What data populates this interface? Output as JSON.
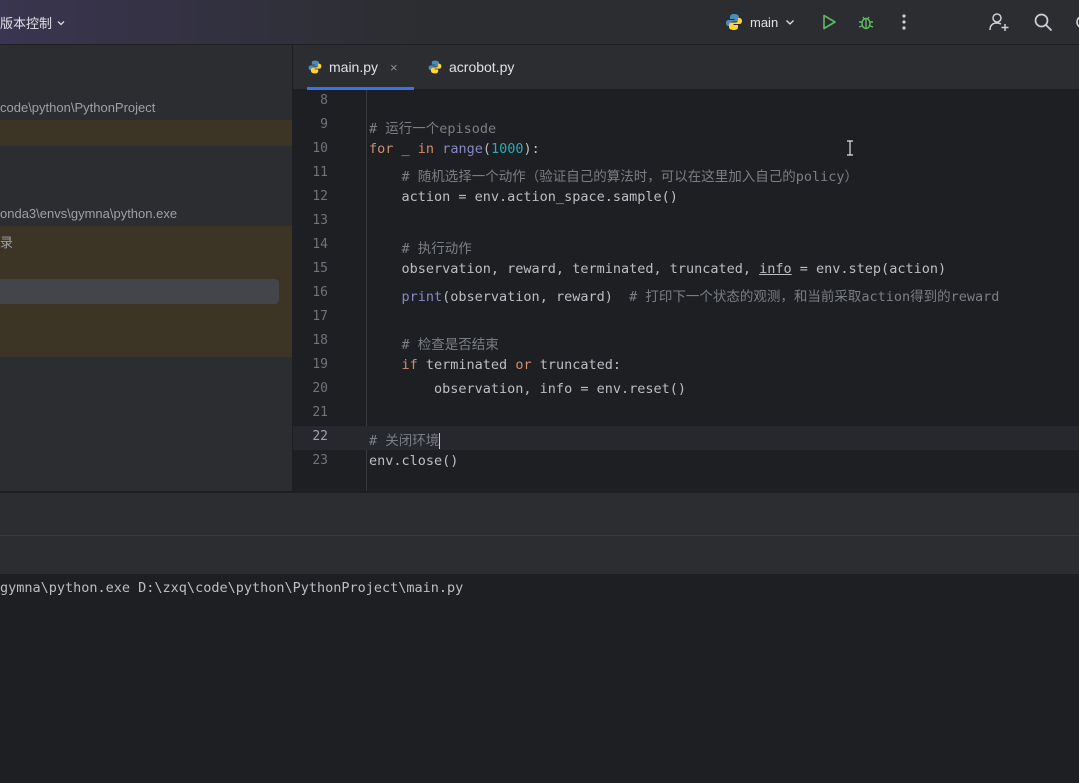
{
  "titlebar": {
    "vcs_label": "版本控制",
    "run_config": "main",
    "colors": {
      "run": "#5fb865",
      "debug": "#5fb865"
    }
  },
  "sidebar": {
    "project_path": "code\\python\\PythonProject",
    "interpreter_path": "onda3\\envs\\gymna\\python.exe",
    "dir_label": "录"
  },
  "tabs": [
    {
      "label": "main.py",
      "close": "×"
    },
    {
      "label": "acrobot.py"
    }
  ],
  "editor": {
    "current_line": 22,
    "lines": [
      {
        "n": "8",
        "text": ""
      },
      {
        "n": "9",
        "comment": "# 运行一个episode"
      },
      {
        "n": "10",
        "kw1": "for",
        "t1": " _ ",
        "kw2": "in",
        "t2": " ",
        "bi": "range",
        "p1": "(",
        "num": "1000",
        "p2": "):"
      },
      {
        "n": "11",
        "indent": "    ",
        "comment": "# 随机选择一个动作（验证自己的算法时，可以在这里加入自己的policy）"
      },
      {
        "n": "12",
        "text": "    action = env.action_space.sample()"
      },
      {
        "n": "13",
        "text": ""
      },
      {
        "n": "14",
        "indent": "    ",
        "comment": "# 执行动作"
      },
      {
        "n": "15",
        "pre": "    observation, reward, terminated, truncated, ",
        "ul": "info",
        "post": " = env.step(action)"
      },
      {
        "n": "16",
        "indent": "    ",
        "bi": "print",
        "mid": "(observation, reward)  ",
        "comment": "# 打印下一个状态的观测，和当前采取action得到的reward"
      },
      {
        "n": "17",
        "text": ""
      },
      {
        "n": "18",
        "indent": "    ",
        "comment": "# 检查是否结束"
      },
      {
        "n": "19",
        "indent": "    ",
        "kw1": "if",
        "t1": " terminated ",
        "kw2": "or",
        "t2": " truncated:"
      },
      {
        "n": "20",
        "text": "        observation, info = env.reset()"
      },
      {
        "n": "21",
        "text": ""
      },
      {
        "n": "22",
        "comment": "# 关闭环境"
      },
      {
        "n": "23",
        "text": "env.close()"
      }
    ]
  },
  "console": {
    "command": "gymna\\python.exe D:\\zxq\\code\\python\\PythonProject\\main.py"
  }
}
